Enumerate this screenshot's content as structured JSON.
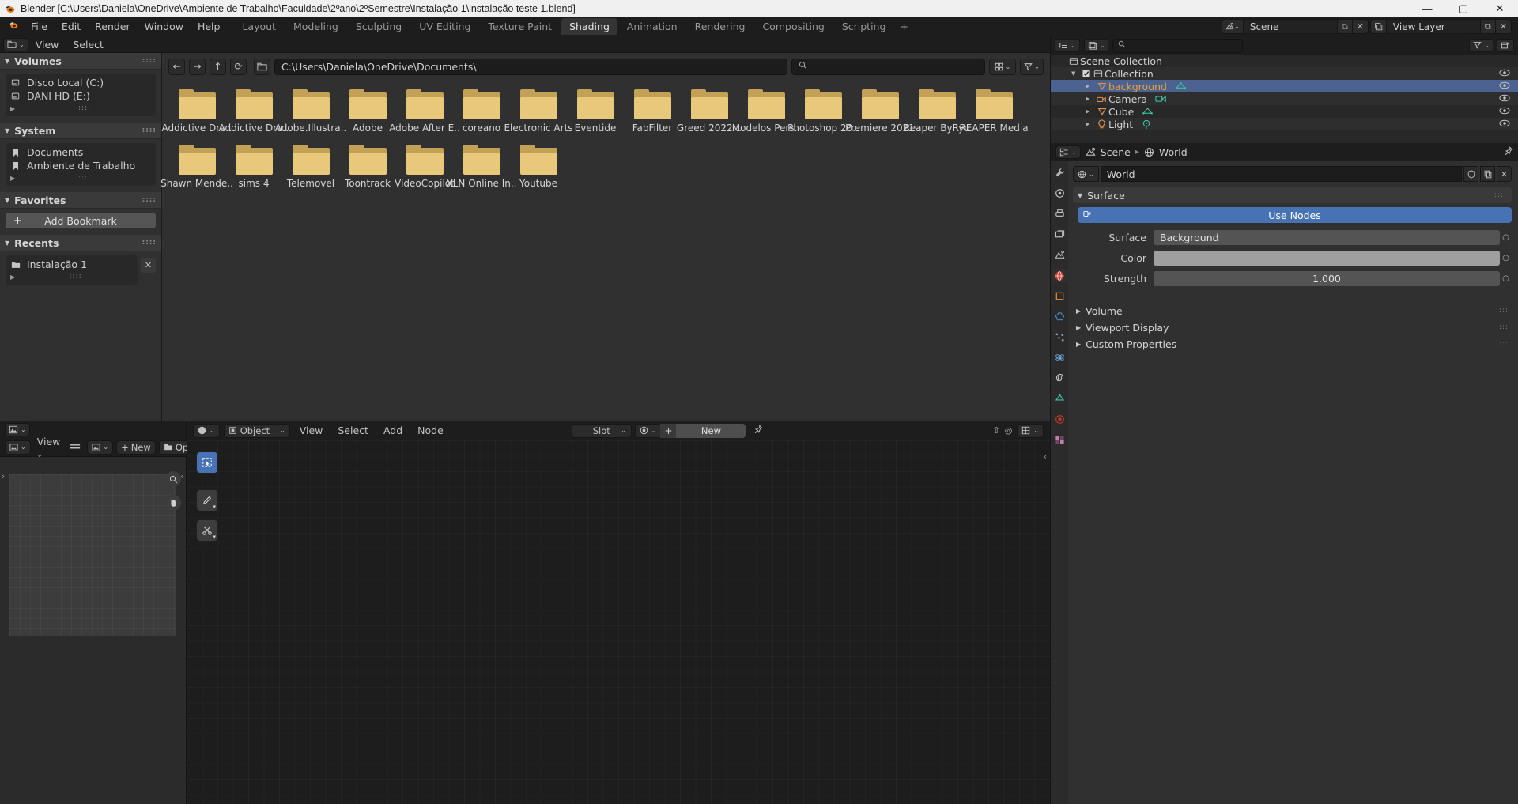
{
  "window": {
    "title": "Blender [C:\\Users\\Daniela\\OneDrive\\Ambiente de Trabalho\\Faculdade\\2ºano\\2ºSemestre\\Instalação 1\\instalação teste 1.blend]",
    "minimize": "—",
    "maximize": "▢",
    "close": "✕"
  },
  "topbar": {
    "logo_icon": "blender-logo",
    "menus": [
      "File",
      "Edit",
      "Render",
      "Window",
      "Help"
    ],
    "workspaces": [
      {
        "label": "Layout",
        "active": false
      },
      {
        "label": "Modeling",
        "active": false
      },
      {
        "label": "Sculpting",
        "active": false
      },
      {
        "label": "UV Editing",
        "active": false
      },
      {
        "label": "Texture Paint",
        "active": false
      },
      {
        "label": "Shading",
        "active": true
      },
      {
        "label": "Animation",
        "active": false
      },
      {
        "label": "Rendering",
        "active": false
      },
      {
        "label": "Compositing",
        "active": false
      },
      {
        "label": "Scripting",
        "active": false
      }
    ],
    "add_workspace": "+",
    "scene": {
      "icon": "scene-icon",
      "value": "Scene",
      "new_icon": "⧉",
      "delete_icon": "✕"
    },
    "view_layer": {
      "icon": "viewlayer-icon",
      "value": "View Layer",
      "new_icon": "⧉",
      "delete_icon": "✕"
    }
  },
  "file_browser": {
    "header": {
      "editor_type_icon": "filebrowser-editor-icon",
      "menus": [
        "View",
        "Select"
      ]
    },
    "toolbar": {
      "back_icon": "←",
      "forward_icon": "→",
      "up_icon": "↑",
      "refresh_icon": "⟳",
      "newfolder_icon": "new-folder-icon",
      "path_value": "C:\\Users\\Daniela\\OneDrive\\Documents\\",
      "search_icon": "search-icon",
      "search_placeholder": "",
      "display_mode_icon": "grid-view-icon",
      "filter_icon": "filter-icon"
    },
    "sidebar": {
      "volumes": {
        "title": "Volumes",
        "items": [
          {
            "label": "Disco Local (C:)",
            "icon": "drive-icon"
          },
          {
            "label": "DANI HD (E:)",
            "icon": "drive-icon"
          }
        ]
      },
      "system": {
        "title": "System",
        "items": [
          {
            "label": "Documents",
            "icon": "bookmark-icon"
          },
          {
            "label": "Ambiente de Trabalho",
            "icon": "bookmark-icon"
          }
        ]
      },
      "favorites": {
        "title": "Favorites",
        "add_bookmark": "Add Bookmark",
        "add_icon": "+"
      },
      "recents": {
        "title": "Recents",
        "items": [
          {
            "label": "Instalação 1",
            "icon": "folder-icon"
          }
        ],
        "clear_icon": "✕"
      }
    },
    "files": [
      "Addictive Dru..",
      "Addictive Dru..",
      "Adobe.Illustra..",
      "Adobe",
      "Adobe After E..",
      "coreano",
      "Electronic Arts",
      "Eventide",
      "FabFilter",
      "Greed  2022...",
      "Modelos Pers..",
      "Photoshop 20..",
      "Premiere 2021",
      "Reaper ByRyu",
      "REAPER Media",
      "Shawn Mende..",
      "sims 4",
      "Telemovel",
      "Toontrack",
      "VideoCopilot",
      "XLN Online In..",
      "Youtube"
    ]
  },
  "image_editor": {
    "editor_type_icon": "image-editor-icon",
    "view_menu": "View",
    "mode_icon": "list-icon",
    "image_icon": "image-icon",
    "new_label": "New",
    "new_icon": "+",
    "open_label": "Open",
    "open_icon": "folder-icon",
    "pin_icon": "pin-icon",
    "zoom_icon": "zoom-icon",
    "pan_icon": "hand-icon"
  },
  "shader_editor": {
    "editor_type_icon": "shading-editor-icon",
    "shader_type": "Object",
    "menus": [
      "View",
      "Select",
      "Add",
      "Node"
    ],
    "slot_label": "Slot",
    "material_icon": "material-icon",
    "add_icon": "+",
    "new_label": "New",
    "pin_icon": "pin-icon",
    "tools": [
      {
        "name": "tweak-tool",
        "icon": "⬚",
        "selected": true
      },
      {
        "name": "annotate-tool",
        "icon": "✎",
        "selected": false
      },
      {
        "name": "link-cut-tool",
        "icon": "✂",
        "selected": false
      }
    ],
    "overlay_icons": [
      "↥",
      "⦿",
      "⊞"
    ],
    "sidebar_arrow": "‹"
  },
  "outliner": {
    "display_mode_icon": "outliner-display-icon",
    "filter_mode_icon": "outliner-filter-icon",
    "search_icon": "search-icon",
    "search_placeholder": "",
    "filter_icon": "filter-icon",
    "new_collection_icon": "new-collection-icon",
    "rows": [
      {
        "label": "Scene Collection",
        "indent": 0,
        "icon": "scene-collection-icon",
        "selected": false,
        "eye": false,
        "checkbox": false,
        "disclosure": ""
      },
      {
        "label": "Collection",
        "indent": 1,
        "icon": "collection-icon",
        "selected": false,
        "eye": true,
        "checkbox": true,
        "disclosure": "▼"
      },
      {
        "label": "background",
        "indent": 2,
        "icon": "mesh-object-icon",
        "selected": true,
        "eye": true,
        "checkbox": false,
        "disclosure": "▶",
        "data_icon": "mesh-data-icon"
      },
      {
        "label": "Camera",
        "indent": 2,
        "icon": "camera-object-icon",
        "selected": false,
        "eye": true,
        "checkbox": false,
        "disclosure": "▶",
        "data_icon": "camera-data-icon"
      },
      {
        "label": "Cube",
        "indent": 2,
        "icon": "mesh-object-icon",
        "selected": false,
        "eye": true,
        "checkbox": false,
        "disclosure": "▶",
        "data_icon": "mesh-data-icon"
      },
      {
        "label": "Light",
        "indent": 2,
        "icon": "light-object-icon",
        "selected": false,
        "eye": true,
        "checkbox": false,
        "disclosure": "▶",
        "data_icon": "light-data-icon"
      }
    ]
  },
  "properties": {
    "editor_type_icon": "properties-editor-icon",
    "breadcrumb": [
      {
        "label": "Scene",
        "icon": "scene-icon"
      },
      {
        "label": "World",
        "icon": "world-icon"
      }
    ],
    "pin_icon": "pin-icon",
    "id_block": {
      "browse_icon": "world-icon",
      "name": "World",
      "fake_user_icon": "shield-icon",
      "copy_icon": "duplicate-icon",
      "unlink_icon": "✕"
    },
    "tabs": [
      {
        "name": "tool-tab",
        "icon": "tool",
        "active": false
      },
      {
        "name": "render-tab",
        "icon": "render",
        "active": false
      },
      {
        "name": "output-tab",
        "icon": "output",
        "active": false
      },
      {
        "name": "viewlayer-tab",
        "icon": "viewlayer",
        "active": false
      },
      {
        "name": "scene-tab",
        "icon": "scene",
        "active": false
      },
      {
        "name": "world-tab",
        "icon": "world",
        "active": true
      },
      {
        "name": "object-tab",
        "icon": "object",
        "active": false
      },
      {
        "name": "modifier-tab",
        "icon": "modifier",
        "active": false
      },
      {
        "name": "particles-tab",
        "icon": "particles",
        "active": false
      },
      {
        "name": "physics-tab",
        "icon": "physics",
        "active": false
      },
      {
        "name": "constraints-tab",
        "icon": "constraints",
        "active": false
      },
      {
        "name": "data-tab",
        "icon": "data",
        "active": false
      },
      {
        "name": "material-tab",
        "icon": "material",
        "active": false
      },
      {
        "name": "texture-tab",
        "icon": "texture",
        "active": false
      }
    ],
    "surface_panel": {
      "title": "Surface",
      "use_nodes": "Use Nodes",
      "use_nodes_icon": "nodetree-icon",
      "rows": [
        {
          "label": "Surface",
          "value": "Background",
          "type": "enum"
        },
        {
          "label": "Color",
          "value": "",
          "type": "color",
          "color": "#9f9f9f"
        },
        {
          "label": "Strength",
          "value": "1.000",
          "type": "number"
        }
      ]
    },
    "collapsed_panels": [
      "Volume",
      "Viewport Display",
      "Custom Properties"
    ]
  },
  "colors": {
    "accent_blue": "#4772b3",
    "folder_yellow": "#e8c87a",
    "folder_shadow": "#c2a055",
    "selection_blue": "#4c6290",
    "orange_text": "#e8a33c"
  }
}
